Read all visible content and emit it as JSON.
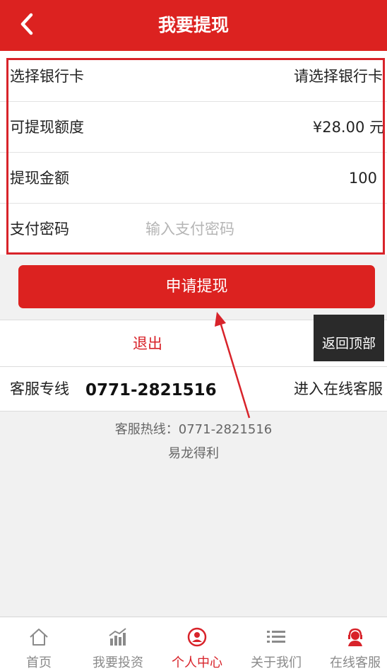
{
  "header": {
    "title": "我要提现"
  },
  "form": {
    "bank_label": "选择银行卡",
    "bank_value": "请选择银行卡",
    "limit_label": "可提现额度",
    "limit_value": "¥28.00 元",
    "amount_label": "提现金额",
    "amount_value": "100",
    "password_label": "支付密码",
    "password_placeholder": "输入支付密码"
  },
  "apply_button": "申请提现",
  "logout": "退出",
  "back_to_top": "返回顶部",
  "service": {
    "label": "客服专线",
    "phone": "0771-2821516",
    "online": "进入在线客服"
  },
  "footer": {
    "hotline": "客服热线：0771-2821516",
    "company": "易龙得利"
  },
  "tabs": [
    {
      "label": "首页",
      "icon": "home-icon"
    },
    {
      "label": "我要投资",
      "icon": "chart-icon"
    },
    {
      "label": "个人中心",
      "icon": "user-icon"
    },
    {
      "label": "关于我们",
      "icon": "list-icon"
    },
    {
      "label": "在线客服",
      "icon": "support-icon"
    }
  ],
  "colors": {
    "brand": "#dc2220",
    "annotation": "#d8232a"
  }
}
